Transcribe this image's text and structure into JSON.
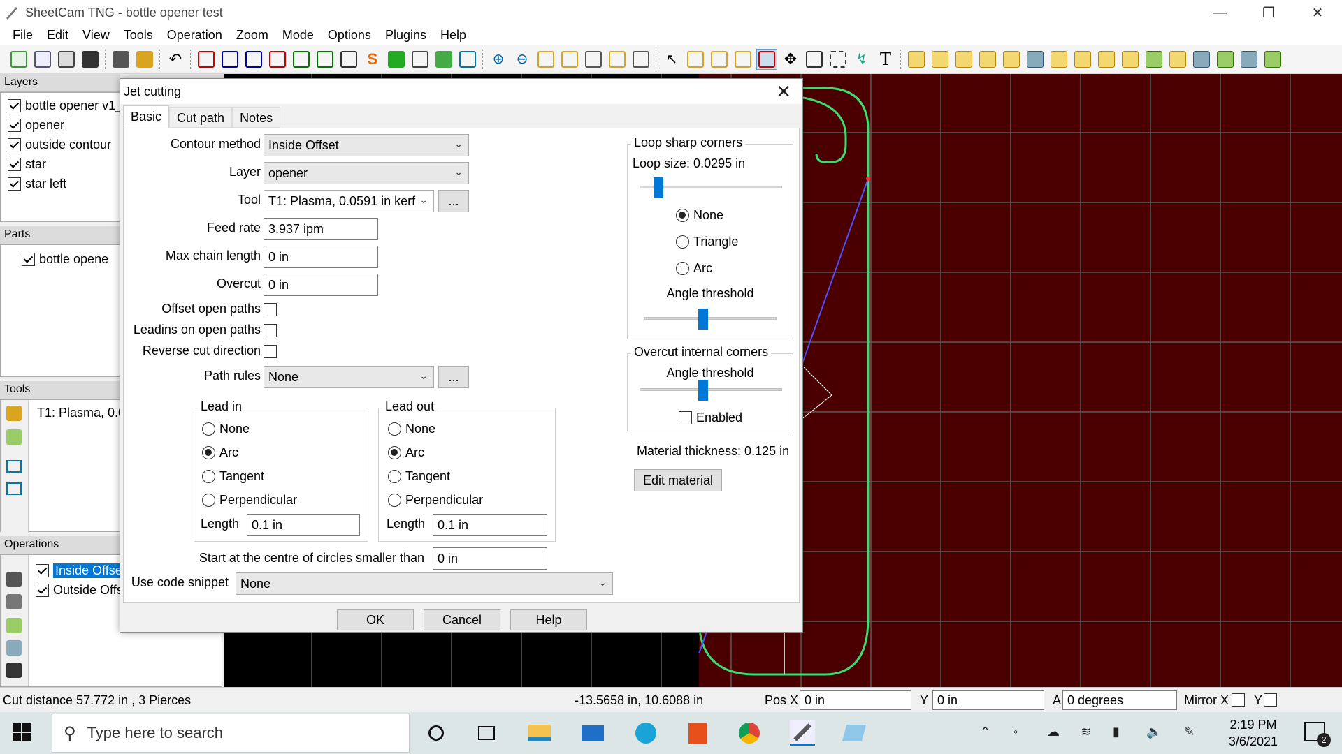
{
  "window": {
    "title": "SheetCam TNG - bottle opener test"
  },
  "menu": [
    "File",
    "Edit",
    "View",
    "Tools",
    "Operation",
    "Zoom",
    "Mode",
    "Options",
    "Plugins",
    "Help"
  ],
  "panels": {
    "layers": {
      "title": "Layers",
      "items": [
        "bottle opener v1_",
        "opener",
        "outside contour",
        "star",
        "star left"
      ]
    },
    "parts": {
      "title": "Parts",
      "items": [
        "bottle opene"
      ]
    },
    "tools": {
      "title": "Tools",
      "items": [
        "T1: Plasma, 0.0"
      ]
    },
    "operations": {
      "title": "Operations",
      "items": [
        "Inside Offse",
        "Outside Offs"
      ]
    }
  },
  "dialog": {
    "title": "Jet cutting",
    "tabs": [
      "Basic",
      "Cut path",
      "Notes"
    ],
    "labels": {
      "contour_method": "Contour method",
      "layer": "Layer",
      "tool": "Tool",
      "feed_rate": "Feed rate",
      "max_chain": "Max chain length",
      "overcut": "Overcut",
      "offset_open": "Offset open paths",
      "leadins_open": "Leadins on open paths",
      "reverse": "Reverse cut direction",
      "path_rules": "Path rules",
      "centre_circles": "Start at the centre of circles smaller than",
      "code_snippet": "Use code snippet",
      "length": "Length",
      "ellipsis": "..."
    },
    "values": {
      "contour_method": "Inside Offset",
      "layer": "opener",
      "tool": "T1: Plasma, 0.0591 in kerf",
      "feed_rate": "3.937 ipm",
      "max_chain": "0 in",
      "overcut": "0 in",
      "path_rules": "None",
      "centre_circles": "0 in",
      "code_snippet": "None",
      "lead_in_length": "0.1 in",
      "lead_out_length": "0.1 in"
    },
    "lead_in": {
      "title": "Lead in",
      "options": [
        "None",
        "Arc",
        "Tangent",
        "Perpendicular"
      ],
      "selected": "Arc"
    },
    "lead_out": {
      "title": "Lead out",
      "options": [
        "None",
        "Arc",
        "Tangent",
        "Perpendicular"
      ],
      "selected": "Arc"
    },
    "loop": {
      "title": "Loop sharp corners",
      "size_label": "Loop size: 0.0295 in",
      "options": [
        "None",
        "Triangle",
        "Arc"
      ],
      "selected": "None",
      "angle_label": "Angle threshold"
    },
    "overcut_corners": {
      "title": "Overcut internal corners",
      "angle_label": "Angle threshold",
      "enabled_label": "Enabled"
    },
    "material_thickness": "Material thickness: 0.125 in",
    "edit_material": "Edit material",
    "buttons": {
      "ok": "OK",
      "cancel": "Cancel",
      "help": "Help"
    }
  },
  "status": {
    "cut_distance": "Cut distance 57.772 in , 3 Pierces",
    "coords": "-13.5658 in, 10.6088 in",
    "pos_x_label": "Pos X",
    "pos_x": "0 in",
    "y_label": "Y",
    "y": "0 in",
    "a_label": "A",
    "a": "0 degrees",
    "mirror_x": "Mirror X",
    "mirror_y": "Y"
  },
  "taskbar": {
    "search_placeholder": "Type here to search",
    "time": "2:19 PM",
    "date": "3/6/2021",
    "notifications": "2"
  },
  "colors": {
    "canvas_bg": "#4a0000",
    "grid": "#5a5a5a",
    "path": "#3ddc6e",
    "accent": "#0078d7"
  }
}
